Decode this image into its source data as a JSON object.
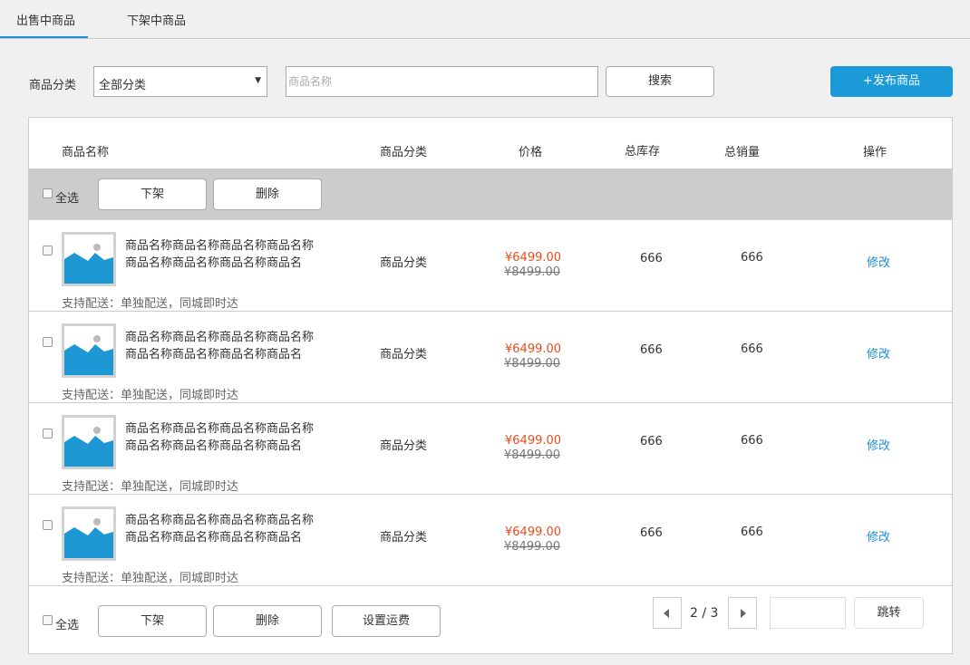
{
  "tabs": [
    {
      "label": "出售中商品",
      "active": true
    },
    {
      "label": "下架中商品",
      "active": false
    }
  ],
  "filter": {
    "category_label": "商品分类",
    "category_value": "全部分类",
    "name_placeholder": "商品名称",
    "search_label": "搜索",
    "publish_label": "+发布商品"
  },
  "table": {
    "headers": {
      "name": "商品名称",
      "category": "商品分类",
      "price": "价格",
      "stock": "总库存",
      "sales": "总销量",
      "actions": "操作"
    },
    "select_all_label": "全选",
    "bulk_actions": {
      "offline": "下架",
      "delete": "删除",
      "shipping": "设置运费"
    },
    "rows": [
      {
        "name": "商品名称商品名称商品名称商品名称商品名称商品名称商品名称商品名",
        "category": "商品分类",
        "price": "¥6499.00",
        "original_price": "¥8499.00",
        "stock": "666",
        "sales": "666",
        "action": "修改",
        "shipping_info": "支持配送：单独配送，同城即时达"
      },
      {
        "name": "商品名称商品名称商品名称商品名称商品名称商品名称商品名称商品名",
        "category": "商品分类",
        "price": "¥6499.00",
        "original_price": "¥8499.00",
        "stock": "666",
        "sales": "666",
        "action": "修改",
        "shipping_info": "支持配送：单独配送，同城即时达"
      },
      {
        "name": "商品名称商品名称商品名称商品名称商品名称商品名称商品名称商品名",
        "category": "商品分类",
        "price": "¥6499.00",
        "original_price": "¥8499.00",
        "stock": "666",
        "sales": "666",
        "action": "修改",
        "shipping_info": "支持配送：单独配送，同城即时达"
      },
      {
        "name": "商品名称商品名称商品名称商品名称商品名称商品名称商品名称商品名",
        "category": "商品分类",
        "price": "¥6499.00",
        "original_price": "¥8499.00",
        "stock": "666",
        "sales": "666",
        "action": "修改",
        "shipping_info": "支持配送：单独配送，同城即时达"
      }
    ]
  },
  "pagination": {
    "page_text": "2 / 3",
    "jump_label": "跳转",
    "jump_value": ""
  },
  "colors": {
    "accent": "#1a9ad7",
    "price": "#e84d1c",
    "link": "#1a8fd6"
  }
}
